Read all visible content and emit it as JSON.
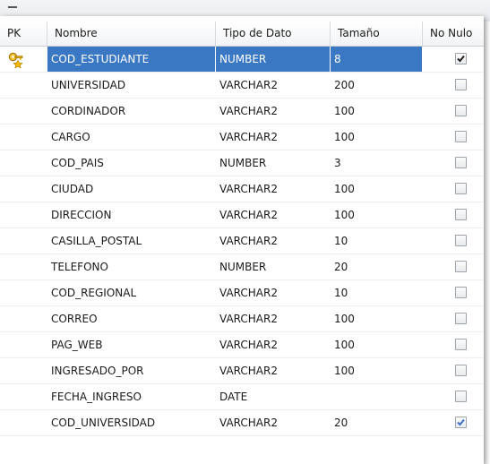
{
  "table": {
    "columns": [
      "PK",
      "Nombre",
      "Tipo de Dato",
      "Tamaño",
      "No Nulo"
    ],
    "rows": [
      {
        "pk": true,
        "nombre": "COD_ESTUDIANTE",
        "tipo": "NUMBER",
        "tamano": "8",
        "no_nulo": true,
        "selected": true
      },
      {
        "pk": false,
        "nombre": "UNIVERSIDAD",
        "tipo": "VARCHAR2",
        "tamano": "200",
        "no_nulo": false
      },
      {
        "pk": false,
        "nombre": "CORDINADOR",
        "tipo": "VARCHAR2",
        "tamano": "100",
        "no_nulo": false
      },
      {
        "pk": false,
        "nombre": "CARGO",
        "tipo": "VARCHAR2",
        "tamano": "100",
        "no_nulo": false
      },
      {
        "pk": false,
        "nombre": "COD_PAIS",
        "tipo": "NUMBER",
        "tamano": "3",
        "no_nulo": false
      },
      {
        "pk": false,
        "nombre": "CIUDAD",
        "tipo": "VARCHAR2",
        "tamano": "100",
        "no_nulo": false
      },
      {
        "pk": false,
        "nombre": "DIRECCION",
        "tipo": "VARCHAR2",
        "tamano": "100",
        "no_nulo": false
      },
      {
        "pk": false,
        "nombre": "CASILLA_POSTAL",
        "tipo": "VARCHAR2",
        "tamano": "10",
        "no_nulo": false
      },
      {
        "pk": false,
        "nombre": "TELEFONO",
        "tipo": "NUMBER",
        "tamano": "20",
        "no_nulo": false
      },
      {
        "pk": false,
        "nombre": "COD_REGIONAL",
        "tipo": "VARCHAR2",
        "tamano": "10",
        "no_nulo": false
      },
      {
        "pk": false,
        "nombre": "CORREO",
        "tipo": "VARCHAR2",
        "tamano": "100",
        "no_nulo": false
      },
      {
        "pk": false,
        "nombre": "PAG_WEB",
        "tipo": "VARCHAR2",
        "tamano": "100",
        "no_nulo": false
      },
      {
        "pk": false,
        "nombre": "INGRESADO_POR",
        "tipo": "VARCHAR2",
        "tamano": "100",
        "no_nulo": false
      },
      {
        "pk": false,
        "nombre": "FECHA_INGRESO",
        "tipo": "DATE",
        "tamano": "",
        "no_nulo": false
      },
      {
        "pk": false,
        "nombre": "COD_UNIVERSIDAD",
        "tipo": "VARCHAR2",
        "tamano": "20",
        "no_nulo": true
      }
    ]
  },
  "icons": {
    "primary_key": "key-icon",
    "checked": "checkmark-icon"
  },
  "colors": {
    "selection": "#3b78c4",
    "check_dark": "#1f1f1f",
    "check_blue": "#3a6fc9"
  }
}
